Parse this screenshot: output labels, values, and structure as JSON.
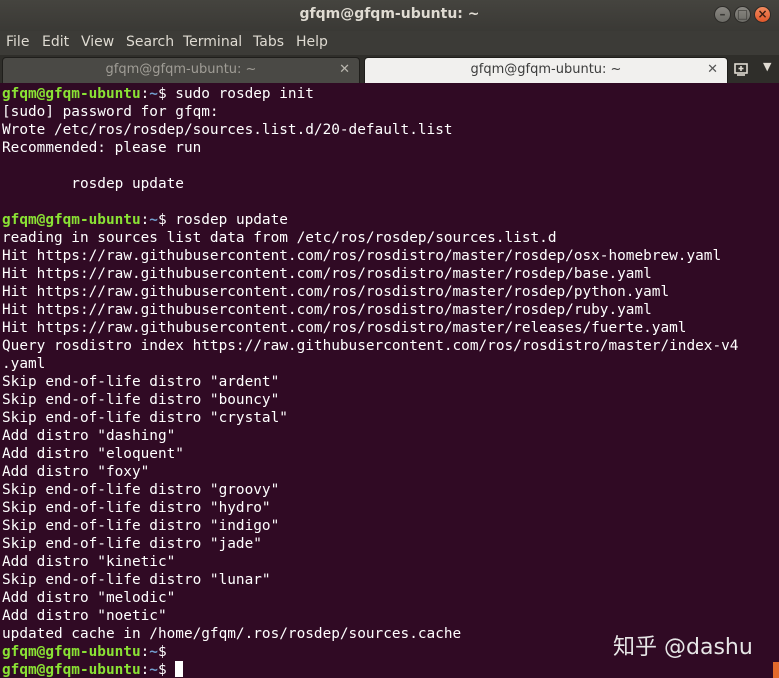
{
  "window": {
    "title": "gfqm@gfqm-ubuntu: ~"
  },
  "menu": [
    "File",
    "Edit",
    "View",
    "Search",
    "Terminal",
    "Tabs",
    "Help"
  ],
  "tabs": [
    {
      "label": "gfqm@gfqm-ubuntu: ~",
      "active": false
    },
    {
      "label": "gfqm@gfqm-ubuntu: ~",
      "active": true
    }
  ],
  "prompt": {
    "user": "gfqm@gfqm-ubuntu",
    "sep": ":",
    "path": "~",
    "sigil": "$ "
  },
  "lines": [
    {
      "kind": "prompt",
      "text": "sudo rosdep init"
    },
    {
      "kind": "out",
      "text": "[sudo] password for gfqm:"
    },
    {
      "kind": "out",
      "text": "Wrote /etc/ros/rosdep/sources.list.d/20-default.list"
    },
    {
      "kind": "out",
      "text": "Recommended: please run"
    },
    {
      "kind": "out",
      "text": ""
    },
    {
      "kind": "out",
      "text": "        rosdep update"
    },
    {
      "kind": "out",
      "text": ""
    },
    {
      "kind": "prompt",
      "text": "rosdep update"
    },
    {
      "kind": "out",
      "text": "reading in sources list data from /etc/ros/rosdep/sources.list.d"
    },
    {
      "kind": "out",
      "text": "Hit https://raw.githubusercontent.com/ros/rosdistro/master/rosdep/osx-homebrew.yaml"
    },
    {
      "kind": "out",
      "text": "Hit https://raw.githubusercontent.com/ros/rosdistro/master/rosdep/base.yaml"
    },
    {
      "kind": "out",
      "text": "Hit https://raw.githubusercontent.com/ros/rosdistro/master/rosdep/python.yaml"
    },
    {
      "kind": "out",
      "text": "Hit https://raw.githubusercontent.com/ros/rosdistro/master/rosdep/ruby.yaml"
    },
    {
      "kind": "out",
      "text": "Hit https://raw.githubusercontent.com/ros/rosdistro/master/releases/fuerte.yaml"
    },
    {
      "kind": "out",
      "text": "Query rosdistro index https://raw.githubusercontent.com/ros/rosdistro/master/index-v4"
    },
    {
      "kind": "out",
      "text": ".yaml"
    },
    {
      "kind": "out",
      "text": "Skip end-of-life distro \"ardent\""
    },
    {
      "kind": "out",
      "text": "Skip end-of-life distro \"bouncy\""
    },
    {
      "kind": "out",
      "text": "Skip end-of-life distro \"crystal\""
    },
    {
      "kind": "out",
      "text": "Add distro \"dashing\""
    },
    {
      "kind": "out",
      "text": "Add distro \"eloquent\""
    },
    {
      "kind": "out",
      "text": "Add distro \"foxy\""
    },
    {
      "kind": "out",
      "text": "Skip end-of-life distro \"groovy\""
    },
    {
      "kind": "out",
      "text": "Skip end-of-life distro \"hydro\""
    },
    {
      "kind": "out",
      "text": "Skip end-of-life distro \"indigo\""
    },
    {
      "kind": "out",
      "text": "Skip end-of-life distro \"jade\""
    },
    {
      "kind": "out",
      "text": "Add distro \"kinetic\""
    },
    {
      "kind": "out",
      "text": "Skip end-of-life distro \"lunar\""
    },
    {
      "kind": "out",
      "text": "Add distro \"melodic\""
    },
    {
      "kind": "out",
      "text": "Add distro \"noetic\""
    },
    {
      "kind": "out",
      "text": "updated cache in /home/gfqm/.ros/rosdep/sources.cache"
    },
    {
      "kind": "prompt",
      "text": ""
    },
    {
      "kind": "prompt",
      "text": "",
      "cursor": true
    }
  ],
  "watermark": "知乎 @dashu",
  "colors": {
    "background": "#300a24",
    "user": "#8ae234",
    "path": "#729fcf",
    "text": "#ffffff"
  }
}
